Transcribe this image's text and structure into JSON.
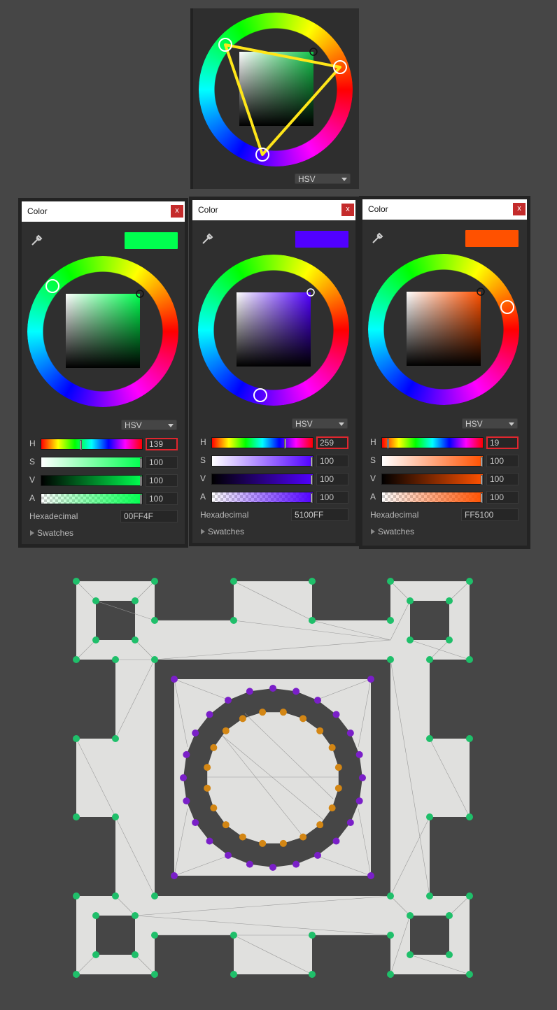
{
  "top_panel": {
    "mode": "HSV"
  },
  "pickers": [
    {
      "title": "Color",
      "close_label": "x",
      "color": "#00FF4F",
      "mode": "HSV",
      "channels": [
        {
          "label": "H",
          "value": "139"
        },
        {
          "label": "S",
          "value": "100"
        },
        {
          "label": "V",
          "value": "100"
        },
        {
          "label": "A",
          "value": "100"
        }
      ],
      "hex_label": "Hexadecimal",
      "hex_value": "00FF4F",
      "swatches_label": "Swatches"
    },
    {
      "title": "Color",
      "close_label": "x",
      "color": "#5100FF",
      "mode": "HSV",
      "channels": [
        {
          "label": "H",
          "value": "259"
        },
        {
          "label": "S",
          "value": "100"
        },
        {
          "label": "V",
          "value": "100"
        },
        {
          "label": "A",
          "value": "100"
        }
      ],
      "hex_label": "Hexadecimal",
      "hex_value": "5100FF",
      "swatches_label": "Swatches"
    },
    {
      "title": "Color",
      "close_label": "x",
      "color": "#FF5100",
      "mode": "HSV",
      "channels": [
        {
          "label": "H",
          "value": "19"
        },
        {
          "label": "S",
          "value": "100"
        },
        {
          "label": "V",
          "value": "100"
        },
        {
          "label": "A",
          "value": "100"
        }
      ],
      "hex_label": "Hexadecimal",
      "hex_value": "FF5100",
      "swatches_label": "Swatches"
    }
  ],
  "colors": {
    "outer_vertex": "#1fbf6a",
    "inner_ring_vertex": "#7a1fc8",
    "innermost_ring_vertex": "#d38614",
    "mesh_fill": "#e0e0de",
    "highlight": "#e0262e",
    "triad_line": "#ffe619"
  }
}
